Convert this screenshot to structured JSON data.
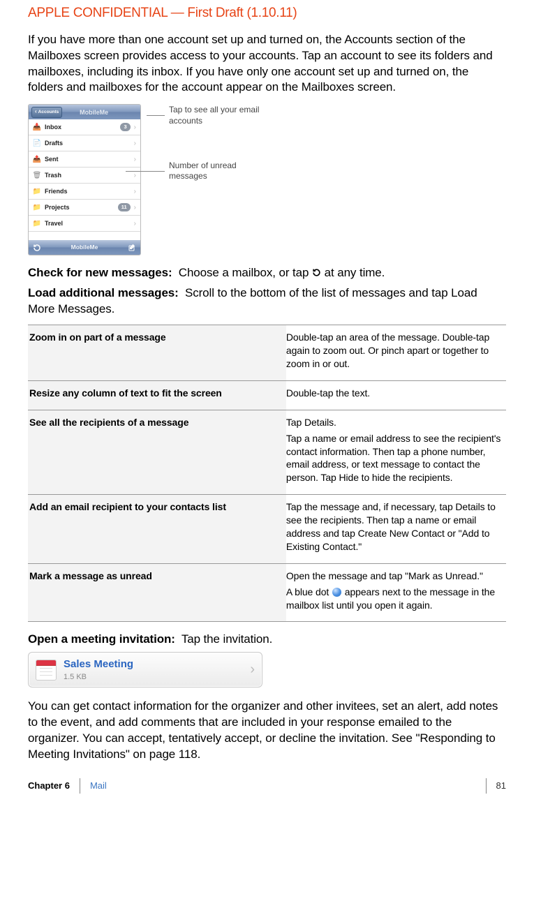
{
  "header": {
    "confidential": "APPLE CONFIDENTIAL — First Draft (1.10.11)"
  },
  "intro": "If you have more than one account set up and turned on, the Accounts section of the Mailboxes screen provides access to your accounts. Tap an account to see its folders and mailboxes, including its inbox. If you have only one account set up and turned on, the folders and mailboxes for the account appear on the Mailboxes screen.",
  "phone": {
    "accounts_button": "Accounts",
    "nav_title": "MobileMe",
    "rows": [
      {
        "icon": "📥",
        "label": "Inbox",
        "badge": "3"
      },
      {
        "icon": "📄",
        "label": "Drafts",
        "badge": ""
      },
      {
        "icon": "📤",
        "label": "Sent",
        "badge": ""
      },
      {
        "icon": "🗑",
        "label": "Trash",
        "badge": ""
      },
      {
        "icon": "📁",
        "label": "Friends",
        "badge": ""
      },
      {
        "icon": "📁",
        "label": "Projects",
        "badge": "11"
      },
      {
        "icon": "📁",
        "label": "Travel",
        "badge": ""
      }
    ],
    "toolbar_title": "MobileMe"
  },
  "callouts": {
    "top": "Tap to see all your email accounts",
    "bottom": "Number of unread messages"
  },
  "actions": {
    "check_bold": "Check for new messages:",
    "check_rest_a": "Choose a mailbox, or tap ",
    "check_rest_b": " at any time.",
    "load_bold": "Load additional messages:",
    "load_rest": "Scroll to the bottom of the list of messages and tap Load More Messages."
  },
  "table": [
    {
      "left": "Zoom in on part of a message",
      "right": [
        "Double-tap an area of the message. Double-tap again to zoom out. Or pinch apart or together to zoom in or out."
      ]
    },
    {
      "left": "Resize any column of text to fit the screen",
      "right": [
        "Double-tap the text."
      ]
    },
    {
      "left": "See all the recipients of a message",
      "right": [
        "Tap Details.",
        "Tap a name or email address to see the recipient's contact information. Then tap a phone number, email address, or text message to contact the person. Tap Hide to hide the recipients."
      ]
    },
    {
      "left": "Add an email recipient to your contacts list",
      "right": [
        "Tap the message and, if necessary, tap Details to see the recipients. Then tap a name or email address and tap Create New Contact or \"Add to Existing Contact.\""
      ]
    },
    {
      "left": "Mark a message as unread",
      "right_parts": {
        "a": "Open the message and tap \"Mark as Unread.\"",
        "b1": "A blue dot ",
        "b2": " appears next to the message in the mailbox list until you open it again."
      }
    }
  ],
  "open_meeting": {
    "bold": "Open a meeting invitation:",
    "rest": "Tap the invitation."
  },
  "meeting": {
    "title": "Sales Meeting",
    "size": "1.5 KB"
  },
  "meeting_para": "You can get contact information for the organizer and other invitees, set an alert, add notes to the event, and add comments that are included in your response emailed to the organizer. You can accept, tentatively accept, or decline the invitation. See \"Responding to Meeting Invitations\" on page 118.",
  "footer": {
    "chapter": "Chapter 6",
    "name": "Mail",
    "page": "81"
  }
}
